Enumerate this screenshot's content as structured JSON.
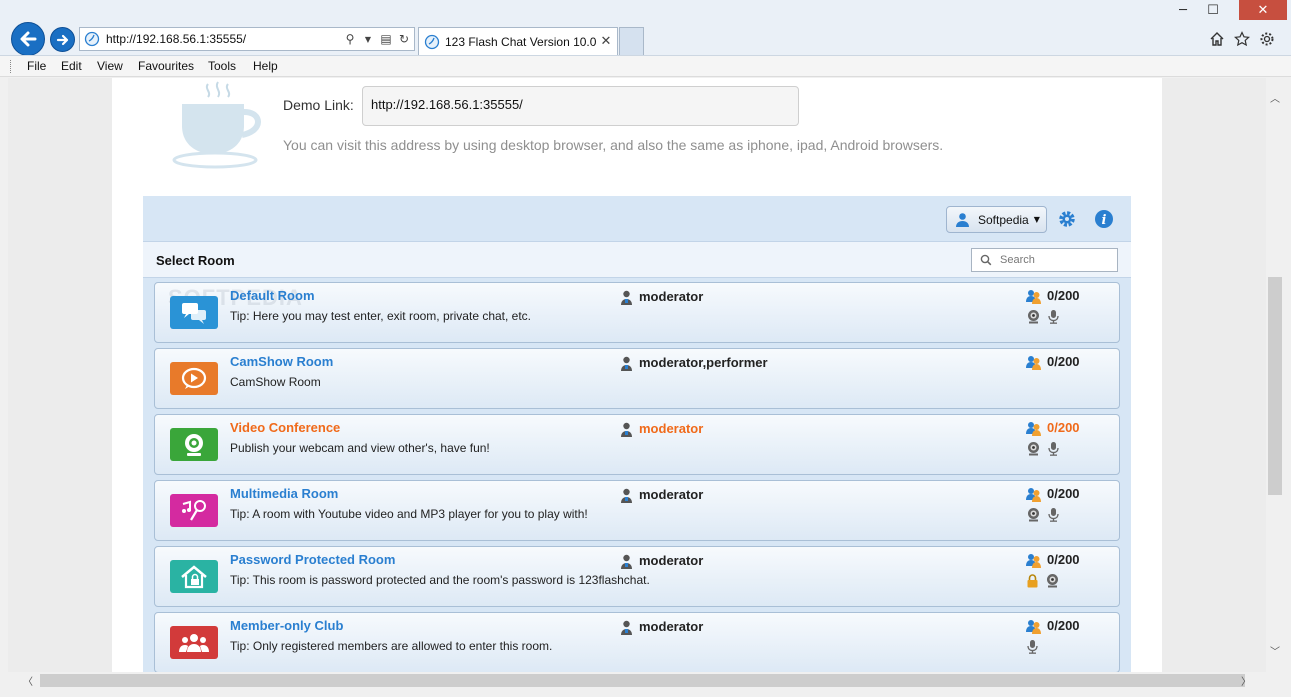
{
  "browser": {
    "url": "http://192.168.56.1:35555/",
    "tab_title": "123 Flash Chat Version 10.0 ...",
    "close_label": "✕"
  },
  "menu": [
    "File",
    "Edit",
    "View",
    "Favourites",
    "Tools",
    "Help"
  ],
  "demo": {
    "label": "Demo Link:",
    "url": "http://192.168.56.1:35555/",
    "hint": "You can visit this address by using desktop browser, and also the same as iphone, ipad, Android browsers."
  },
  "chat": {
    "user": "Softpedia",
    "select_room_label": "Select Room",
    "search_placeholder": "Search",
    "watermark": "SOFTPEDIA"
  },
  "rooms": [
    {
      "name": "Default Room",
      "tip": "Tip: Here you may test enter, exit room, private chat, etc.",
      "role": "moderator",
      "count": "0/200",
      "icon": "chat-bubbles-icon",
      "color": "#2a93d6",
      "features": [
        "webcam-icon",
        "microphone-icon"
      ]
    },
    {
      "name": "CamShow Room",
      "tip": "CamShow Room",
      "role": "moderator,performer",
      "count": "0/200",
      "icon": "play-bubble-icon",
      "color": "#e87a2a",
      "features": []
    },
    {
      "name": "Video Conference",
      "tip": "Publish your webcam and view other's, have fun!",
      "role": "moderator",
      "count": "0/200",
      "icon": "webcam-icon",
      "color": "#3aa63a",
      "features": [
        "webcam-icon",
        "microphone-icon"
      ],
      "highlight": true
    },
    {
      "name": "Multimedia Room",
      "tip": "Tip: A room with Youtube video and MP3 player for you to play with!",
      "role": "moderator",
      "count": "0/200",
      "icon": "music-mic-icon",
      "color": "#d42aa0",
      "features": [
        "webcam-icon",
        "microphone-icon"
      ]
    },
    {
      "name": "Password Protected Room",
      "tip": "Tip: This room is password protected and the room's password is 123flashchat.",
      "role": "moderator",
      "count": "0/200",
      "icon": "house-lock-icon",
      "color": "#2ab3a3",
      "features": [
        "lock-icon",
        "webcam-icon"
      ]
    },
    {
      "name": "Member-only Club",
      "tip": "Tip: Only registered members are allowed to enter this room.",
      "role": "moderator",
      "count": "0/200",
      "icon": "group-icon",
      "color": "#d23a3a",
      "features": [
        "microphone-icon"
      ]
    }
  ]
}
